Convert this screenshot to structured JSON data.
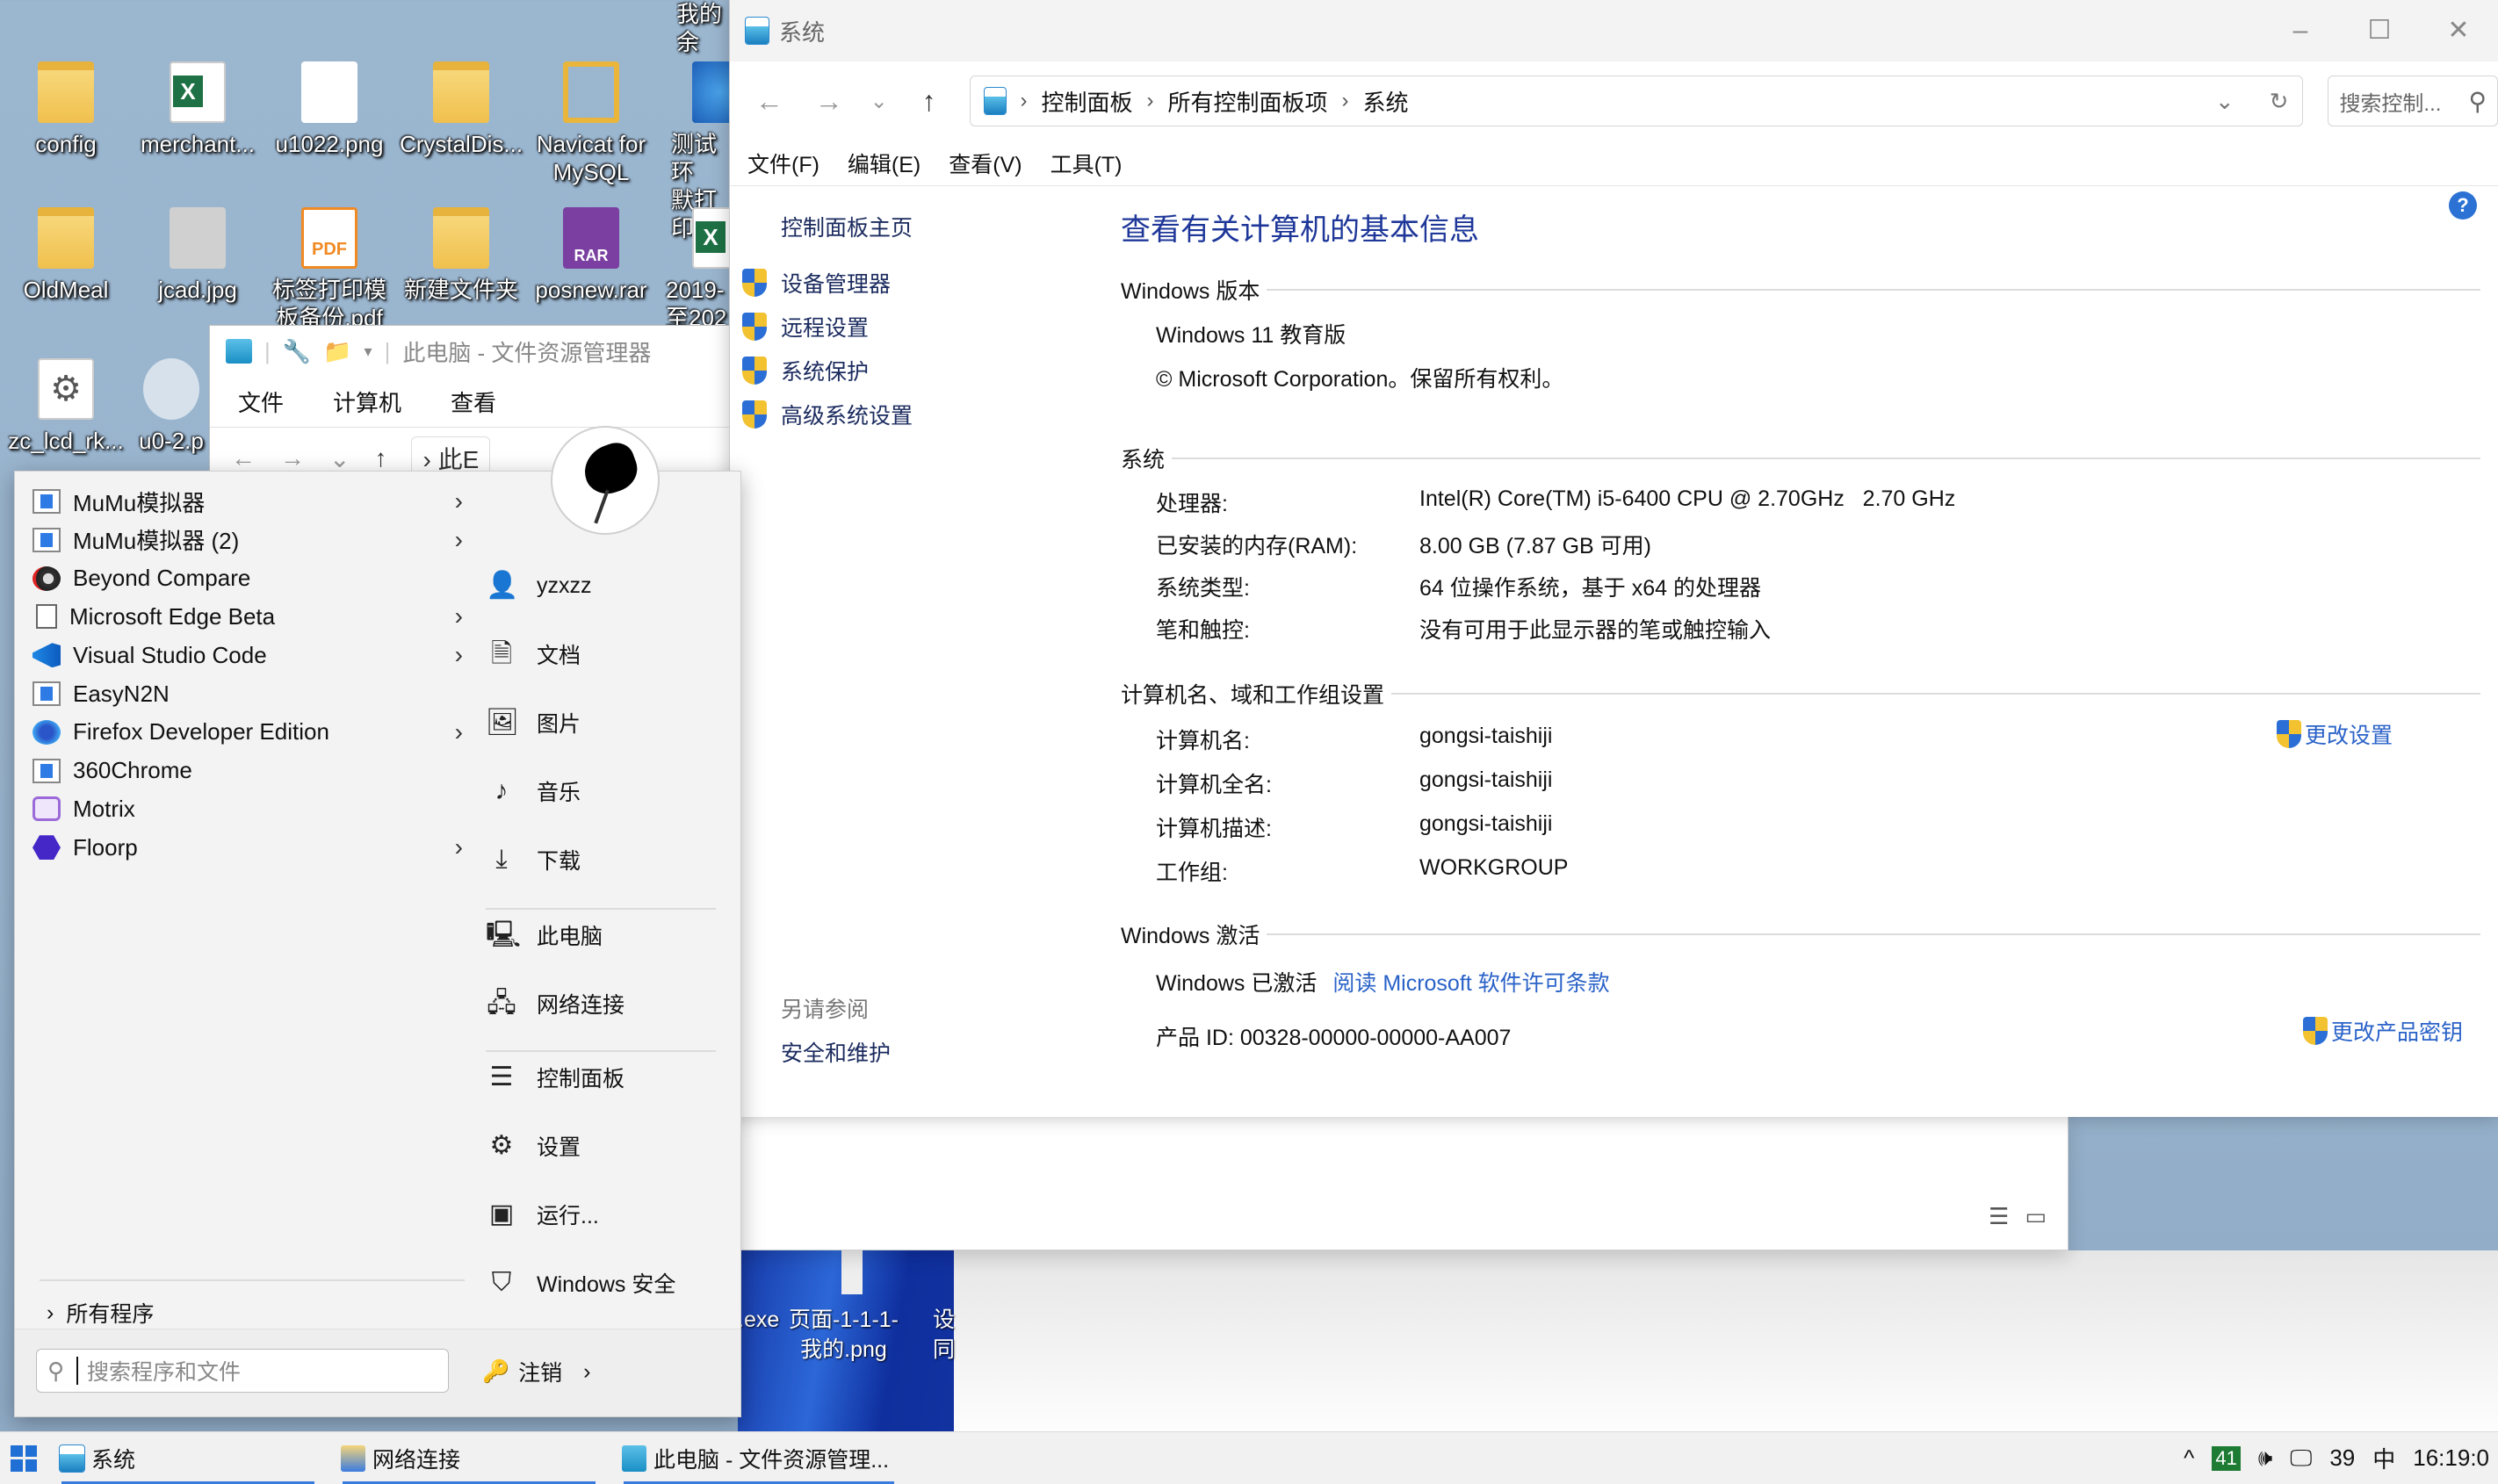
{
  "desktop": {
    "top_partial_label": "我的余",
    "icons": [
      {
        "name": "config",
        "label": "config",
        "type": "folder"
      },
      {
        "name": "merchant",
        "label": "merchant...",
        "type": "excel"
      },
      {
        "name": "u1022",
        "label": "u1022.png",
        "type": "image"
      },
      {
        "name": "crystaldisk",
        "label": "CrystalDis...",
        "type": "folder"
      },
      {
        "name": "navicat",
        "label": "Navicat for\nMySQL",
        "type": "navicat"
      },
      {
        "name": "test-env",
        "label": "测试环\n默打印",
        "type": "ie"
      },
      {
        "name": "oldmeal",
        "label": "OldMeal",
        "type": "folder"
      },
      {
        "name": "jcad",
        "label": "jcad.jpg",
        "type": "image"
      },
      {
        "name": "label-print-pdf",
        "label": "标签打印模\n板备份.pdf",
        "type": "pdf"
      },
      {
        "name": "new-folder",
        "label": "新建文件夹",
        "type": "folder"
      },
      {
        "name": "posnew",
        "label": "posnew.rar",
        "type": "rar"
      },
      {
        "name": "xlsx-2019",
        "label": "2019-\n至202",
        "type": "excel"
      },
      {
        "name": "zc-lcd",
        "label": "zc_lcd_rk...",
        "type": "config"
      },
      {
        "name": "u0-2",
        "label": "u0-2.p",
        "type": "image"
      }
    ],
    "lower_icons": [
      {
        "label": ".exe"
      },
      {
        "label": "页面-1-1-1-\n我的.png"
      },
      {
        "label": "设\n同"
      }
    ]
  },
  "explorer_bg": {
    "title": "此电脑 - 文件资源管理器",
    "menu": [
      "文件",
      "计算机",
      "查看"
    ],
    "address_partial": "此E"
  },
  "system_window": {
    "title": "系统",
    "controls": {
      "minimize": "–",
      "maximize": "☐",
      "close": "✕"
    },
    "nav": {
      "back": "←",
      "forward": "→",
      "recent": "⌄",
      "up": "↑"
    },
    "breadcrumb": [
      "控制面板",
      "所有控制面板项",
      "系统"
    ],
    "search_placeholder": "搜索控制...",
    "menubar": [
      "文件(F)",
      "编辑(E)",
      "查看(V)",
      "工具(T)"
    ],
    "left_pane": {
      "home": "控制面板主页",
      "links": [
        "设备管理器",
        "远程设置",
        "系统保护",
        "高级系统设置"
      ],
      "see_also_heading": "另请参阅",
      "see_also_links": [
        "安全和维护"
      ]
    },
    "main": {
      "page_title": "查看有关计算机的基本信息",
      "windows_edition": {
        "heading": "Windows 版本",
        "edition": "Windows 11 教育版",
        "copyright": "© Microsoft Corporation。保留所有权利。"
      },
      "system": {
        "heading": "系统",
        "rows": [
          {
            "label": "处理器:",
            "value": "Intel(R) Core(TM) i5-6400 CPU @ 2.70GHz   2.70 GHz"
          },
          {
            "label": "已安装的内存(RAM):",
            "value": "8.00 GB (7.87 GB 可用)"
          },
          {
            "label": "系统类型:",
            "value": "64 位操作系统，基于 x64 的处理器"
          },
          {
            "label": "笔和触控:",
            "value": "没有可用于此显示器的笔或触控输入"
          }
        ]
      },
      "computer_name": {
        "heading": "计算机名、域和工作组设置",
        "change_link": "更改设置",
        "rows": [
          {
            "label": "计算机名:",
            "value": "gongsi-taishiji"
          },
          {
            "label": "计算机全名:",
            "value": "gongsi-taishiji"
          },
          {
            "label": "计算机描述:",
            "value": "gongsi-taishiji"
          },
          {
            "label": "工作组:",
            "value": "WORKGROUP"
          }
        ]
      },
      "activation": {
        "heading": "Windows 激活",
        "status": "Windows 已激活",
        "license_link": "阅读 Microsoft 软件许可条款",
        "product_id": "产品 ID: 00328-00000-00000-AA007",
        "change_key_link": "更改产品密钥"
      },
      "help": "?"
    }
  },
  "start_menu": {
    "programs": [
      {
        "label": "MuMu模拟器",
        "icon": "app-window-icon",
        "submenu": true
      },
      {
        "label": "MuMu模拟器 (2)",
        "icon": "app-window-icon",
        "submenu": true
      },
      {
        "label": "Beyond Compare",
        "icon": "beyond-compare-icon",
        "submenu": false
      },
      {
        "label": "Microsoft Edge Beta",
        "icon": "blank-document-icon",
        "submenu": true
      },
      {
        "label": "Visual Studio Code",
        "icon": "vscode-icon",
        "submenu": true
      },
      {
        "label": "EasyN2N",
        "icon": "app-window-icon",
        "submenu": false
      },
      {
        "label": "Firefox Developer Edition",
        "icon": "firefox-icon",
        "submenu": true
      },
      {
        "label": "360Chrome",
        "icon": "app-window-icon",
        "submenu": false
      },
      {
        "label": "Motrix",
        "icon": "motrix-icon",
        "submenu": false
      },
      {
        "label": "Floorp",
        "icon": "floorp-icon",
        "submenu": true
      }
    ],
    "all_programs": "所有程序",
    "places": [
      {
        "label": "yzxzz",
        "icon": "user-folder-icon",
        "glyph": "👤"
      },
      {
        "label": "文档",
        "icon": "document-icon",
        "glyph": "🗎"
      },
      {
        "label": "图片",
        "icon": "picture-icon",
        "glyph": "🖼"
      },
      {
        "label": "音乐",
        "icon": "music-note-icon",
        "glyph": "♪"
      },
      {
        "label": "下载",
        "icon": "download-icon",
        "glyph": "⤓"
      },
      {
        "label": "此电脑",
        "icon": "computer-icon",
        "glyph": "🖳"
      },
      {
        "label": "网络连接",
        "icon": "network-icon",
        "glyph": "🖧"
      },
      {
        "label": "控制面板",
        "icon": "control-panel-icon",
        "glyph": "☰"
      },
      {
        "label": "设置",
        "icon": "settings-gear-icon",
        "glyph": "⚙"
      },
      {
        "label": "运行...",
        "icon": "run-icon",
        "glyph": "▣"
      },
      {
        "label": "Windows 安全",
        "icon": "shield-icon",
        "glyph": "⛉"
      }
    ],
    "search_placeholder": "搜索程序和文件",
    "logoff": "注销"
  },
  "taskbar": {
    "items": [
      {
        "label": "系统",
        "icon": "system-icon"
      },
      {
        "label": "网络连接",
        "icon": "network-connections-icon"
      },
      {
        "label": "此电脑 - 文件资源管理...",
        "icon": "this-pc-icon"
      }
    ],
    "tray": {
      "overflow": "^",
      "badge": "41",
      "volume": "🕪",
      "network_count": "39",
      "ime": "中",
      "clock": "16:19:0"
    }
  },
  "colors": {
    "accent_link": "#2a62c8",
    "title_blue": "#1e3799",
    "taskbar_active": "#3a7be0"
  }
}
